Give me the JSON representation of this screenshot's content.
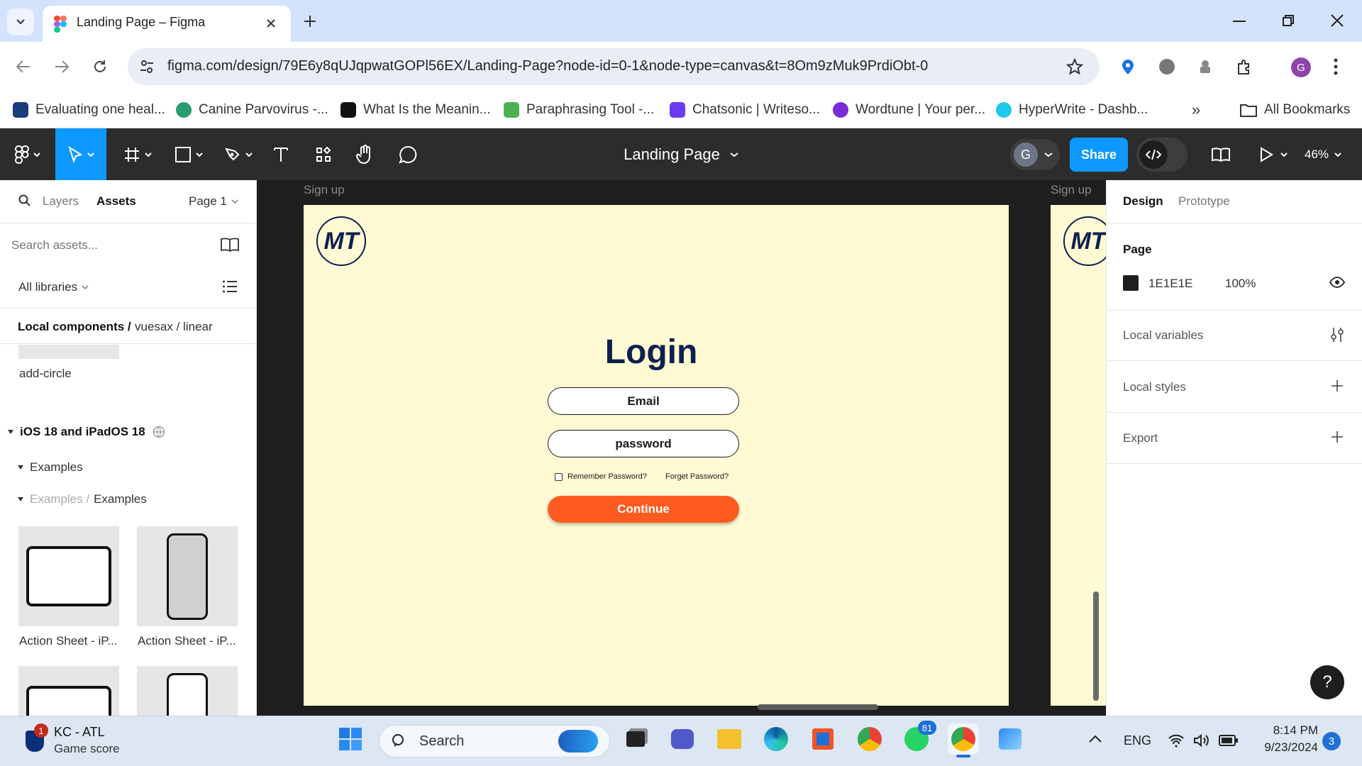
{
  "browser": {
    "tab_title": "Landing Page – Figma",
    "url": "figma.com/design/79E6y8qUJqpwatGOPl56EX/Landing-Page?node-id=0-1&node-type=canvas&t=8Om9zMuk9PrdiObt-0",
    "profile_initial": "G",
    "bookmarks": [
      {
        "label": "Evaluating one heal...",
        "color": "#1a3d7c"
      },
      {
        "label": "Canine Parvovirus -...",
        "color": "#2a9d6e"
      },
      {
        "label": "What Is the Meanin...",
        "color": "#111111"
      },
      {
        "label": "Paraphrasing Tool -...",
        "color": "#4caf50"
      },
      {
        "label": "Chatsonic | Writeso...",
        "color": "#6a3df0"
      },
      {
        "label": "Wordtune | Your per...",
        "color": "#7b2bd6"
      },
      {
        "label": "HyperWrite - Dashb...",
        "color": "#1ec8e8"
      }
    ],
    "more_bookmarks": "»",
    "all_bookmarks": "All Bookmarks"
  },
  "figma": {
    "file_title": "Landing Page",
    "user_initial": "G",
    "share_label": "Share",
    "zoom": "46%",
    "left_panel": {
      "tab_layers": "Layers",
      "tab_assets": "Assets",
      "page": "Page 1",
      "search_placeholder": "Search assets...",
      "libraries": "All libraries",
      "breadcrumb_root": "Local components /",
      "breadcrumb_path": "vuesax / linear",
      "component_1": "add-circle",
      "library_name": "iOS 18 and iPadOS 18",
      "group": "Examples",
      "subgroup_parent": "Examples /",
      "subgroup": "Examples",
      "asset_1": "Action Sheet - iP...",
      "asset_2": "Action Sheet - iP..."
    },
    "right_panel": {
      "tab_design": "Design",
      "tab_prototype": "Prototype",
      "page_heading": "Page",
      "page_color": "1E1E1E",
      "page_opacity": "100%",
      "local_variables": "Local variables",
      "local_styles": "Local styles",
      "export": "Export"
    },
    "canvas": {
      "frame_label": "Sign up",
      "frame2_label": "Sign up",
      "logo": "MT",
      "login_title": "Login",
      "email": "Email",
      "password": "password",
      "remember": "Remember Password?",
      "forget": "Forget Password?",
      "continue": "Continue"
    },
    "help": "?"
  },
  "taskbar": {
    "widget_title": "KC - ATL",
    "widget_sub": "Game score",
    "widget_badge": "1",
    "search": "Search",
    "whatsapp_badge": "81",
    "lang": "ENG",
    "time": "8:14 PM",
    "date": "9/23/2024",
    "notif_count": "3"
  },
  "colors": {
    "accent": "#0d99ff",
    "continue": "#ff5a1f",
    "frame_bg": "#fffad3",
    "brand_navy": "#0f1f4f"
  }
}
